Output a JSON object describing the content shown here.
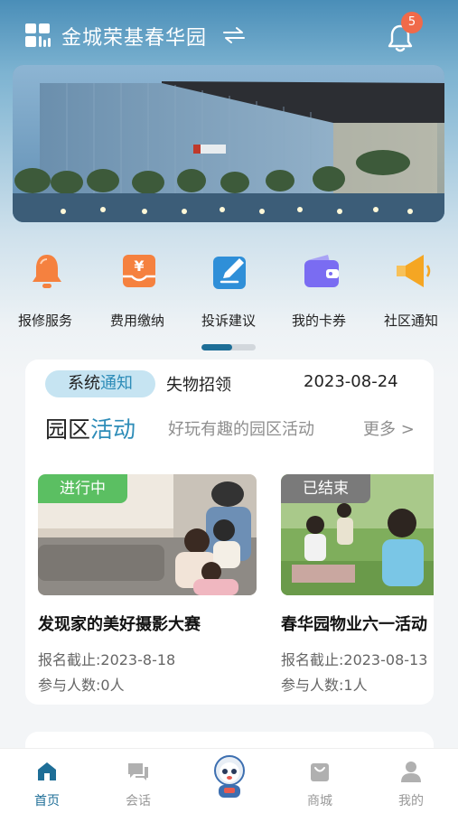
{
  "header": {
    "community_name": "金城荣基春华园",
    "notification_count": "5"
  },
  "menu": [
    {
      "label": "报修服务",
      "icon": "bell-icon"
    },
    {
      "label": "费用缴纳",
      "icon": "payment-icon"
    },
    {
      "label": "投诉建议",
      "icon": "edit-icon"
    },
    {
      "label": "我的卡券",
      "icon": "wallet-icon"
    },
    {
      "label": "社区通知",
      "icon": "megaphone-icon"
    }
  ],
  "notice": {
    "tag_part1": "系统",
    "tag_part2": "通知",
    "text": "失物招领",
    "date": "2023-08-24"
  },
  "activities_section": {
    "title_part1": "园区",
    "title_part2": "活动",
    "subtitle": "好玩有趣的园区活动",
    "more": "更多 >"
  },
  "activities": [
    {
      "status": "进行中",
      "title": "发现家的美好摄影大赛",
      "deadline": "报名截止:2023-8-18",
      "participants": "参与人数:0人"
    },
    {
      "status": "已结束",
      "title": "春华园物业六一活动",
      "deadline": "报名截止:2023-08-13",
      "participants": "参与人数:1人"
    }
  ],
  "tabbar": [
    {
      "label": "首页",
      "icon": "home-icon",
      "active": true
    },
    {
      "label": "会话",
      "icon": "chat-icon",
      "active": false
    },
    {
      "label": "",
      "icon": "mascot-icon",
      "active": false
    },
    {
      "label": "商城",
      "icon": "shopping-bag-icon",
      "active": false
    },
    {
      "label": "我的",
      "icon": "user-icon",
      "active": false
    }
  ],
  "colors": {
    "accent": "#2d8cb8",
    "active_tab": "#1e6e97",
    "ongoing_status": "#5bbf62",
    "ended_status": "#7a7a7a",
    "badge": "#f06a4a"
  }
}
